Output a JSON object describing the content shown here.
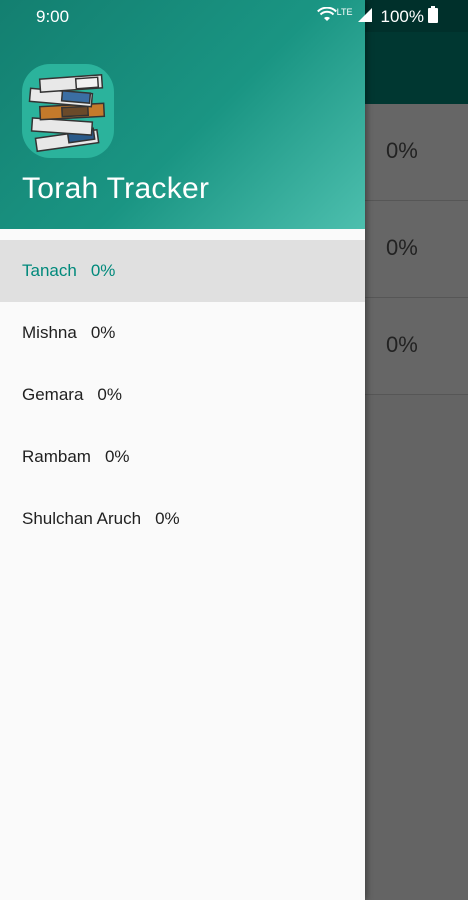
{
  "status_bar": {
    "time": "9:00",
    "network": "LTE",
    "battery": "100%",
    "icons": [
      "wifi-icon",
      "signal-icon",
      "battery-icon"
    ]
  },
  "background_list": {
    "items": [
      {
        "percent": "0%"
      },
      {
        "percent": "0%"
      },
      {
        "percent": "0%"
      }
    ]
  },
  "drawer": {
    "app_title": "Torah Tracker",
    "logo": "books-stack-logo",
    "items": [
      {
        "label": "Tanach",
        "percent": "0%",
        "selected": true
      },
      {
        "label": "Mishna",
        "percent": "0%",
        "selected": false
      },
      {
        "label": "Gemara",
        "percent": "0%",
        "selected": false
      },
      {
        "label": "Rambam",
        "percent": "0%",
        "selected": false
      },
      {
        "label": "Shulchan Aruch",
        "percent": "0%",
        "selected": false
      }
    ]
  },
  "colors": {
    "primary": "#00897b",
    "primary_dark": "#00796b",
    "accent_selected_text": "#00897b",
    "selected_bg": "#e0e0e0"
  }
}
